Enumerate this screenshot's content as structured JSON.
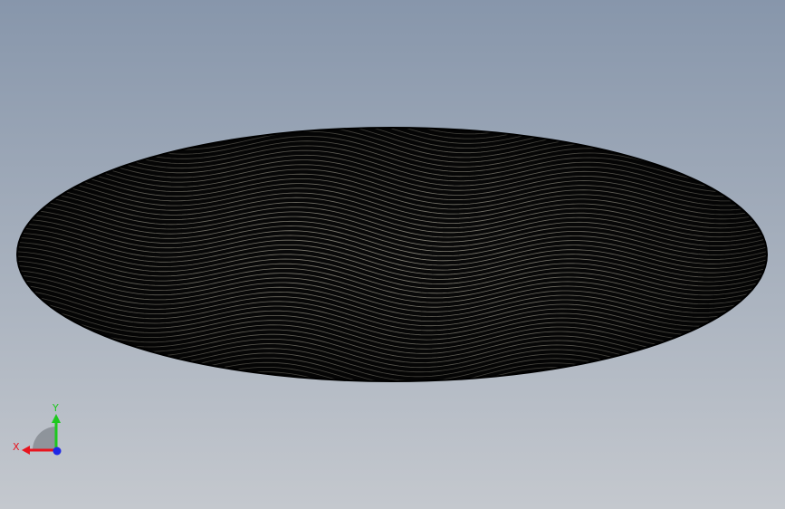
{
  "viewport": {
    "model": "ellipse-surface"
  },
  "triad": {
    "x_label": "X",
    "y_label": "Y",
    "x_color": "#e8141e",
    "y_color": "#1ec81e",
    "z_color": "#1e28e6"
  },
  "colors": {
    "background_top": "#8796ab",
    "background_bottom": "#c4c8ce",
    "model_fill": "#0a0a0a",
    "model_stripe": "#b8b4a4"
  }
}
